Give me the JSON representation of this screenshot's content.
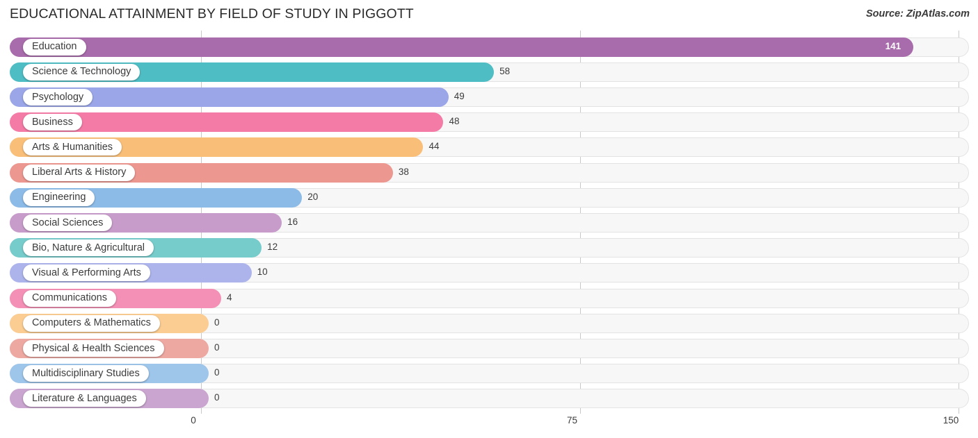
{
  "header": {
    "title": "EDUCATIONAL ATTAINMENT BY FIELD OF STUDY IN PIGGOTT",
    "source": "Source: ZipAtlas.com"
  },
  "chart_data": {
    "type": "bar",
    "orientation": "horizontal",
    "title": "EDUCATIONAL ATTAINMENT BY FIELD OF STUDY IN PIGGOTT",
    "xlabel": "",
    "ylabel": "",
    "xlim": [
      0,
      150
    ],
    "ticks": [
      "0",
      "75",
      "150"
    ],
    "tick_values": [
      0,
      75,
      150
    ],
    "grid": true,
    "legend": false,
    "categories": [
      "Education",
      "Science & Technology",
      "Psychology",
      "Business",
      "Arts & Humanities",
      "Liberal Arts & History",
      "Engineering",
      "Social Sciences",
      "Bio, Nature & Agricultural",
      "Visual & Performing Arts",
      "Communications",
      "Computers & Mathematics",
      "Physical & Health Sciences",
      "Multidisciplinary Studies",
      "Literature & Languages"
    ],
    "values": [
      141,
      58,
      49,
      48,
      44,
      38,
      20,
      16,
      12,
      10,
      4,
      0,
      0,
      0,
      0
    ],
    "value_labels": [
      "141",
      "58",
      "49",
      "48",
      "44",
      "38",
      "20",
      "16",
      "12",
      "10",
      "4",
      "0",
      "0",
      "0",
      "0"
    ],
    "colors": [
      "#a86bab",
      "#4fbdc4",
      "#9aa6e8",
      "#f57ba7",
      "#f9bf79",
      "#ed9791",
      "#8cbbe8",
      "#c79cca",
      "#76cbcb",
      "#adb4ec",
      "#f490b5",
      "#fbcd92",
      "#eda8a1",
      "#9ec5ea",
      "#c9a5cf"
    ]
  },
  "axis": {
    "tick_0": "0",
    "tick_1": "75",
    "tick_2": "150"
  }
}
